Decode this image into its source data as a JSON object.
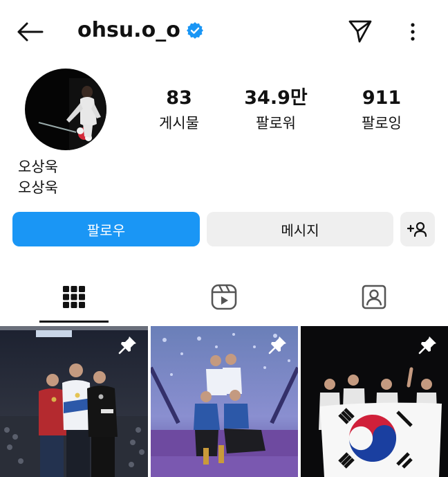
{
  "header": {
    "username": "ohsu.o_o",
    "verified": true,
    "back_icon": "arrow-left-icon",
    "send_icon": "paper-plane-icon",
    "more_icon": "vertical-dots-icon"
  },
  "profile": {
    "posts_count": "83",
    "posts_label": "게시물",
    "followers_count": "34.9만",
    "followers_label": "팔로워",
    "following_count": "911",
    "following_label": "팔로잉",
    "name": "오상욱",
    "bio": "오상욱"
  },
  "actions": {
    "follow_label": "팔로우",
    "message_label": "메시지",
    "add_user_icon": "add-person-icon"
  },
  "tabs": [
    {
      "icon": "grid-icon",
      "active": true
    },
    {
      "icon": "reels-icon",
      "active": false
    },
    {
      "icon": "tagged-person-icon",
      "active": false
    }
  ],
  "posts": [
    {
      "pinned": true
    },
    {
      "pinned": true
    },
    {
      "pinned": true
    }
  ],
  "colors": {
    "accent": "#1a96f5",
    "button_gray": "#efefef",
    "verified": "#1a96f5"
  }
}
